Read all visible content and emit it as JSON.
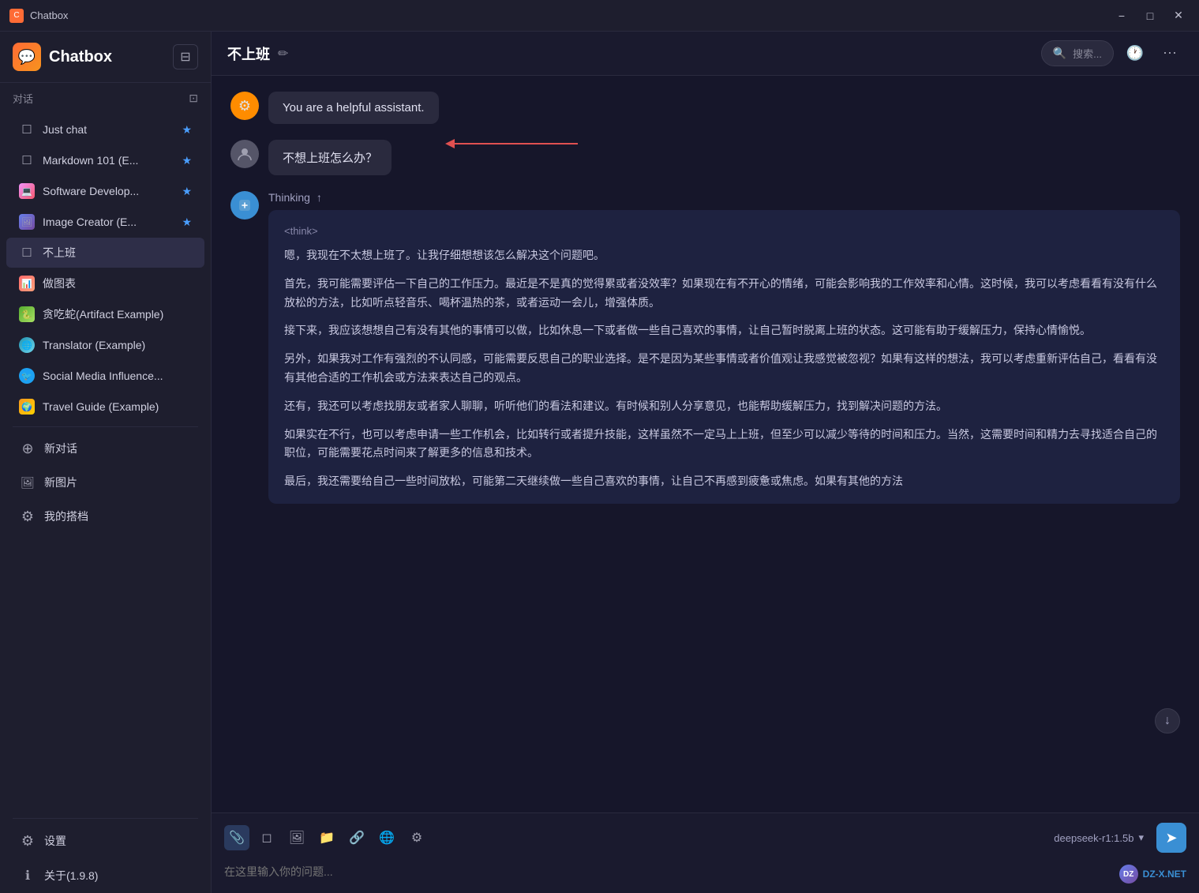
{
  "app": {
    "title": "Chatbox",
    "version": "1.9.8"
  },
  "titlebar": {
    "title": "Chatbox",
    "minimize_label": "−",
    "maximize_label": "□",
    "close_label": "✕"
  },
  "sidebar": {
    "brand": "Chatbox",
    "collapse_icon": "⊟",
    "section_label": "对话",
    "section_archive_icon": "⊡",
    "items": [
      {
        "id": "just-chat",
        "label": "Just chat",
        "icon": "☐",
        "starred": true,
        "type": "chat"
      },
      {
        "id": "markdown",
        "label": "Markdown 101 (E...",
        "icon": "☐",
        "starred": true,
        "type": "chat"
      },
      {
        "id": "software",
        "label": "Software Develop...",
        "icon": "💻",
        "starred": true,
        "type": "special"
      },
      {
        "id": "image-creator",
        "label": "Image Creator (E...",
        "icon": "🖼",
        "starred": true,
        "type": "special"
      },
      {
        "id": "no-work",
        "label": "不上班",
        "icon": "☐",
        "starred": false,
        "type": "chat",
        "active": true
      },
      {
        "id": "chart",
        "label": "做图表",
        "icon": "📊",
        "starred": false,
        "type": "special"
      },
      {
        "id": "snake",
        "label": "贪吃蛇(Artifact Example)",
        "icon": "🐍",
        "starred": false,
        "type": "special"
      },
      {
        "id": "translator",
        "label": "Translator (Example)",
        "icon": "🌐",
        "starred": false,
        "type": "special"
      },
      {
        "id": "social",
        "label": "Social Media Influence...",
        "icon": "🐦",
        "starred": false,
        "type": "special"
      },
      {
        "id": "travel",
        "label": "Travel Guide (Example)",
        "icon": "🌍",
        "starred": false,
        "type": "special"
      }
    ],
    "actions": [
      {
        "id": "new-chat",
        "icon": "⊕",
        "label": "新对话"
      },
      {
        "id": "new-image",
        "icon": "🖼",
        "label": "新图片"
      },
      {
        "id": "my-partner",
        "icon": "⚙",
        "label": "我的搭档"
      }
    ],
    "settings_label": "设置",
    "about_label": "关于(1.9.8)"
  },
  "chat": {
    "title": "不上班",
    "search_placeholder": "搜索...",
    "history_icon": "🕐",
    "more_icon": "⋯"
  },
  "messages": {
    "system": {
      "content": "You are a helpful assistant."
    },
    "user": {
      "content": "不想上班怎么办？"
    },
    "ai": {
      "thinking_label": "Thinking",
      "think_tag": "<think>",
      "paragraphs": [
        "嗯，我现在不太想上班了。让我仔细想想该怎么解决这个问题吧。",
        "首先，我可能需要评估一下自己的工作压力。最近是不是真的觉得累或者没效率？如果现在有不开心的情绪，可能会影响我的工作效率和心情。这时候，我可以考虑看看有没有什么放松的方法，比如听点轻音乐、喝杯温热的茶，或者运动一会儿，增强体质。",
        "接下来，我应该想想自己有没有其他的事情可以做，比如休息一下或者做一些自己喜欢的事情，让自己暂时脱离上班的状态。这可能有助于缓解压力，保持心情愉悦。",
        "另外，如果我对工作有强烈的不认同感，可能需要反思自己的职业选择。是不是因为某些事情或者价值观让我感觉被忽视？如果有这样的想法，我可以考虑重新评估自己，看看有没有其他合适的工作机会或方法来表达自己的观点。",
        "还有，我还可以考虑找朋友或者家人聊聊，听听他们的看法和建议。有时候和别人分享意见，也能帮助缓解压力，找到解决问题的方法。",
        "如果实在不行，也可以考虑申请一些工作机会，比如转行或者提升技能，这样虽然不一定马上上班，但至少可以减少等待的时间和压力。当然，这需要时间和精力去寻找适合自己的职位，可能需要花点时间来了解更多的信息和技术。",
        "最后，我还需要给自己一些时间放松，可能第二天继续做一些自己喜欢的事情，让自己不再感到疲惫或焦虑。如果有其他的方法"
      ]
    }
  },
  "input": {
    "placeholder": "在这里输入你的问题...",
    "model": "deepseek-r1:1.5b",
    "toolbar": {
      "attach_icon": "📎",
      "eraser_icon": "◻",
      "image_icon": "🖼",
      "folder_icon": "📁",
      "link_icon": "🔗",
      "globe_icon": "🌐",
      "sliders_icon": "⚙"
    },
    "send_icon": "➤"
  },
  "watermark": {
    "text": "DZ-X.NET"
  },
  "colors": {
    "accent": "#3a8fd4",
    "background": "#16162a",
    "sidebar_bg": "#1e1e2e",
    "active_item": "#2e2e48",
    "message_bg": "#2a2a3e",
    "thinking_bg": "#1e2240",
    "system_avatar": "#ff8c00",
    "user_avatar": "#555568"
  }
}
